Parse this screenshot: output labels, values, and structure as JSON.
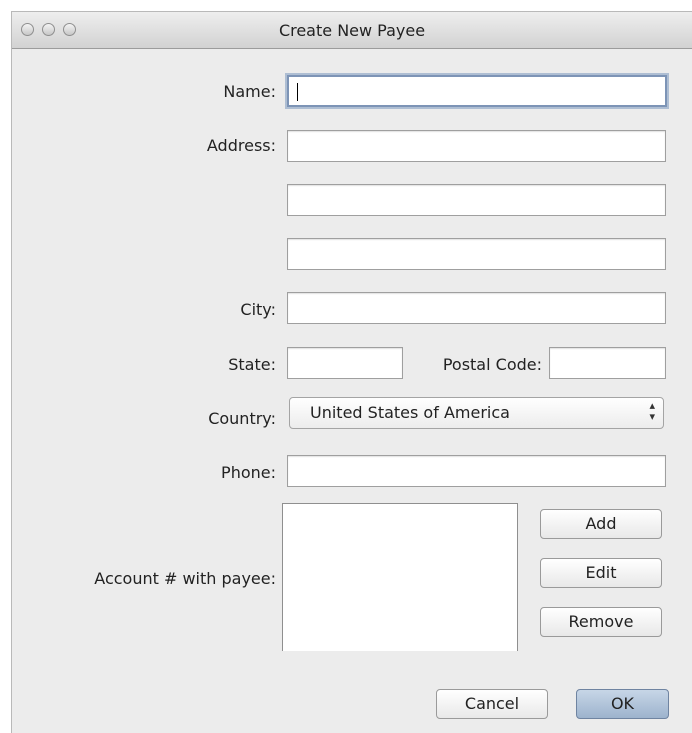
{
  "window": {
    "title": "Create New Payee"
  },
  "form": {
    "name_label": "Name:",
    "name_value": "",
    "address_label": "Address:",
    "address_line1": "",
    "address_line2": "",
    "address_line3": "",
    "city_label": "City:",
    "city_value": "",
    "state_label": "State:",
    "state_value": "",
    "postal_label": "Postal Code:",
    "postal_value": "",
    "country_label": "Country:",
    "country_selected": "United States of America",
    "phone_label": "Phone:",
    "phone_value": "",
    "account_label": "Account # with payee:",
    "account_items": []
  },
  "buttons": {
    "add": "Add",
    "edit": "Edit",
    "remove": "Remove",
    "cancel": "Cancel",
    "ok": "OK"
  },
  "colors": {
    "focus_ring": "#7d94b6",
    "default_button": "#9db3cd"
  }
}
